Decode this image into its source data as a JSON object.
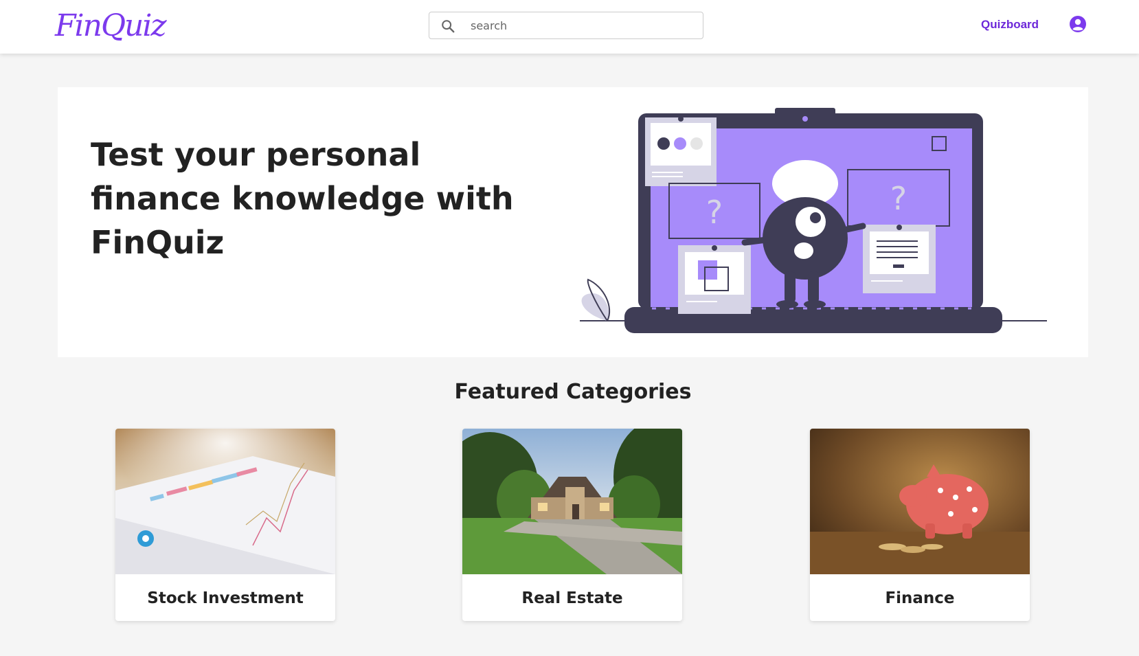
{
  "header": {
    "logo_text": "FinQuiz",
    "search": {
      "placeholder": "search",
      "value": ""
    },
    "nav_link": "Quizboard",
    "icons": {
      "search": "search-icon",
      "user": "user-circle-icon"
    }
  },
  "hero": {
    "title": "Test your personal finance knowledge with FinQuiz",
    "illustration": "laptop-quiz-character-illustration"
  },
  "categories": {
    "title": "Featured Categories",
    "items": [
      {
        "label": "Stock Investment",
        "image": "stock-charts-photo"
      },
      {
        "label": "Real Estate",
        "image": "house-photo"
      },
      {
        "label": "Finance",
        "image": "piggy-bank-photo"
      }
    ]
  },
  "colors": {
    "accent": "#7c3aed",
    "illustration_purple": "#a78bfa",
    "illustration_dark": "#3f3d56"
  }
}
